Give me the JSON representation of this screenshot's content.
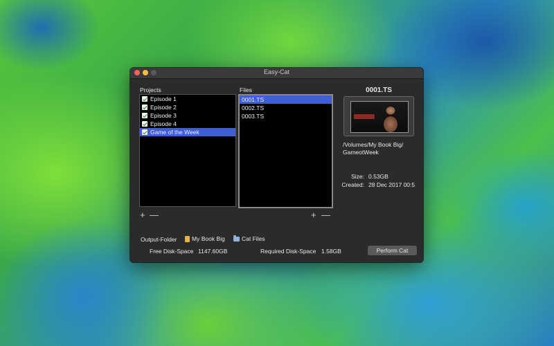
{
  "window": {
    "title": "Easy-Cat"
  },
  "projects": {
    "label": "Projects",
    "items": [
      "Episode 1",
      "Episode 2",
      "Episode 3",
      "Episode 4",
      "Game of the Week"
    ],
    "selected_index": 4
  },
  "files": {
    "label": "Files",
    "items": [
      "0001.TS",
      "0002.TS",
      "0003.TS"
    ],
    "selected_index": 0
  },
  "preview": {
    "filename": "0001.TS",
    "path_line1": "/Volumes/My Book Big/",
    "path_line2": "GameotWeek",
    "size_label": "Size:",
    "size_value": "0.53GB",
    "created_label": "Created:",
    "created_value": "28 Dec 2017 00:5"
  },
  "controls": {
    "add": "+",
    "remove": "—"
  },
  "output": {
    "label": "Output-Folder",
    "drive": "My Book Big",
    "folder": "Cat Files"
  },
  "footer": {
    "free_label": "Free Disk-Space",
    "free_value": "1147.60GB",
    "required_label": "Required Disk-Space",
    "required_value": "1.58GB",
    "perform_label": "Perform Cat"
  }
}
